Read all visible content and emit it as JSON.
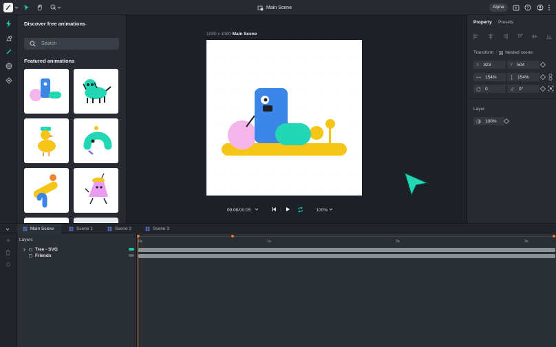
{
  "header": {
    "title": "Main Scene",
    "badge": "Alpha"
  },
  "left_panel": {
    "title": "Discover free animations",
    "search_placeholder": "Search",
    "section_title": "Featured animations"
  },
  "canvas": {
    "size_label": "1080 x 1080",
    "scene_name": "Main Scene"
  },
  "playback": {
    "current_time": "00:00",
    "duration": "/00:05",
    "zoom": "100%"
  },
  "properties": {
    "tabs": [
      "Property",
      "Presets"
    ],
    "transform_label": "Transform",
    "nested_label": "Nested scene",
    "x_key": "X",
    "x_value": "323",
    "y_key": "Y",
    "y_value": "504",
    "scale_w": "154%",
    "scale_h": "154%",
    "rotation": "0",
    "skew": "0°",
    "layer_label": "Layer",
    "opacity": "100%"
  },
  "timeline": {
    "scenes": [
      "Main Scene",
      "Scene 1",
      "Scene 2",
      "Scene 3"
    ],
    "layers_title": "Layers",
    "layers": [
      "Tree - SVG",
      "Friends"
    ],
    "ruler": [
      "0s",
      "1s",
      "2s",
      "3s"
    ]
  },
  "colors": {
    "accent": "#19c7a6",
    "playhead": "#e8742f",
    "panel": "#272b31",
    "canvas_bg": "#1d2026"
  }
}
